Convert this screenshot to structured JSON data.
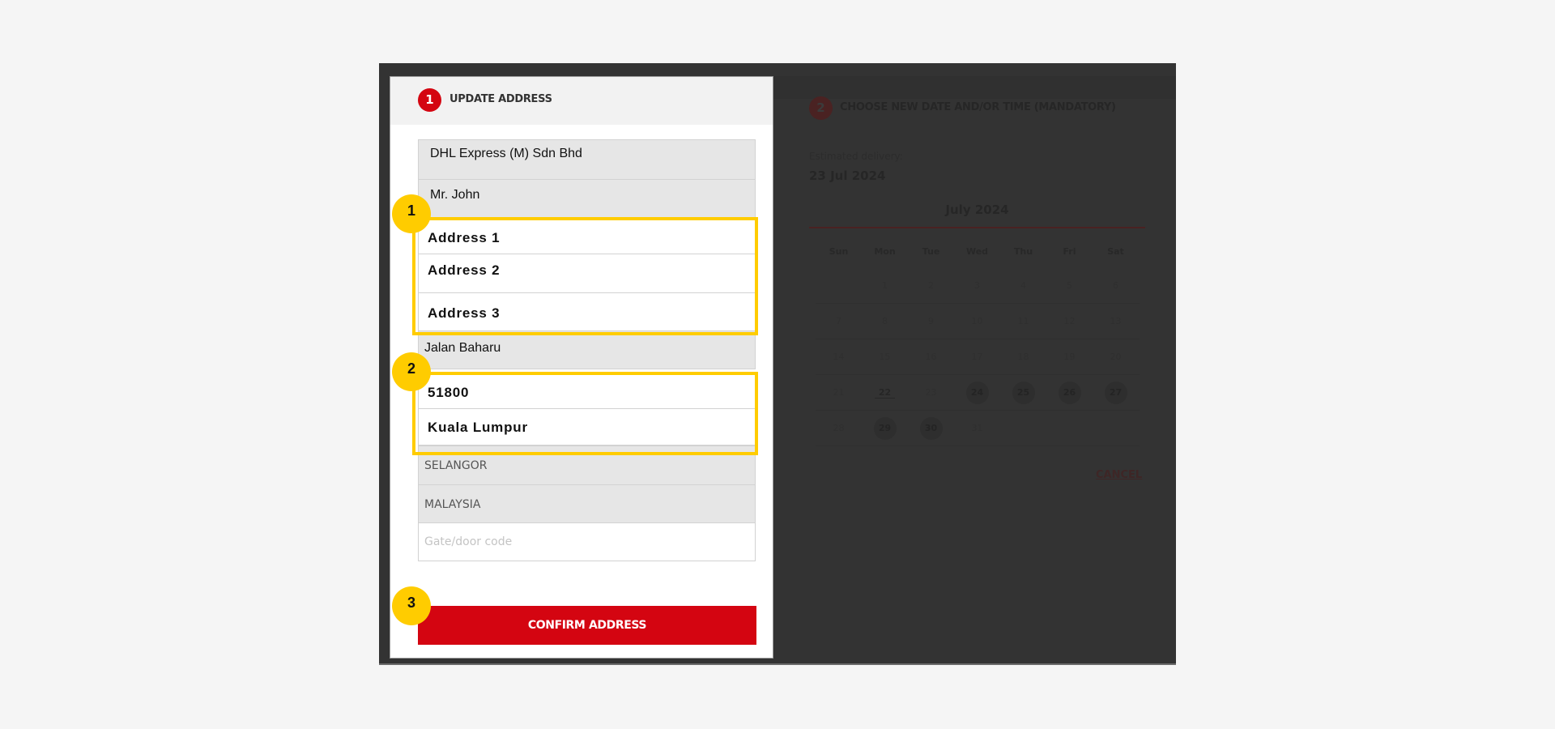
{
  "left_panel": {
    "step_number": "1",
    "title": "UPDATE ADDRESS",
    "fields": {
      "company": "DHL Express (M) Sdn Bhd",
      "contact": "Mr. John",
      "address1": "Address 1",
      "address2": "Address 2",
      "address3": "Address 3",
      "street": "Jalan Baharu",
      "postcode": "51800",
      "city": "Kuala Lumpur",
      "state": "SELANGOR",
      "country": "MALAYSIA",
      "gate_code_placeholder": "Gate/door code"
    },
    "confirm_label": "CONFIRM ADDRESS"
  },
  "annotations": {
    "marker1": "1",
    "marker2": "2",
    "marker3": "3",
    "highlight_color": "#ffcc00"
  },
  "right_panel": {
    "step_number": "2",
    "title": "CHOOSE NEW DATE AND/OR TIME (MANDATORY)",
    "estimated_label": "Estimated delivery:",
    "estimated_date": "23 Jul 2024",
    "calendar": {
      "month": "July 2024",
      "weekdays": [
        "Sun",
        "Mon",
        "Tue",
        "Wed",
        "Thu",
        "Fri",
        "Sat"
      ],
      "weeks": [
        [
          "",
          "1",
          "2",
          "3",
          "4",
          "5",
          "6"
        ],
        [
          "7",
          "8",
          "9",
          "10",
          "11",
          "12",
          "13"
        ],
        [
          "14",
          "15",
          "16",
          "17",
          "18",
          "19",
          "20"
        ],
        [
          "21",
          "22",
          "23",
          "24",
          "25",
          "26",
          "27"
        ],
        [
          "28",
          "29",
          "30",
          "31",
          "",
          "",
          ""
        ]
      ],
      "today": "22",
      "available_days": [
        "24",
        "25",
        "26",
        "27",
        "29",
        "30"
      ]
    },
    "cancel_label": "CANCEL"
  },
  "colors": {
    "brand_red": "#d40511",
    "overlay": "#333333"
  }
}
